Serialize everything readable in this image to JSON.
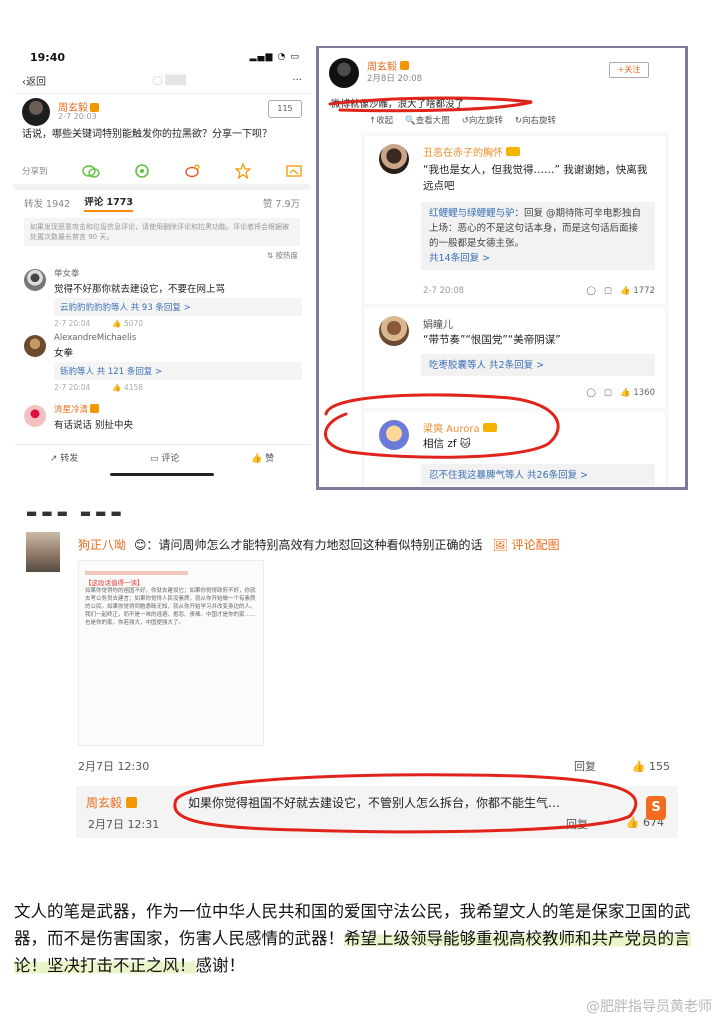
{
  "panel1": {
    "status_time": "19:40",
    "back_label": "返回",
    "post_author": "周玄毅",
    "post_time": "2-7 20:03",
    "follow_count": "115",
    "post_text": "话说，哪些关键词特别能触发你的拉黑欲？分享一下呗？",
    "share_label": "分享到",
    "tab_repost": "转发 1942",
    "tab_comment": "评论 1773",
    "tab_likes": "赞 7.9万",
    "notice": "如果发现恶意攻击和垃圾信息评论，请使用删除评论和拉黑功能。评论者将会根据被处置次数最长禁言 90 天。",
    "sort_label": "按热度",
    "comments": [
      {
        "name": "单女拳",
        "text": "觉得不好那你就去建设它，不要在网上骂",
        "reply": "云豹豹豹豹豹等人  共 93 条回复 >",
        "time": "2-7 20:04",
        "likes": "5070"
      },
      {
        "name": "AlexandreMichaelis",
        "text": "女拳",
        "reply": "铄豹等人  共 121 条回复 >",
        "time": "2-7 20:04",
        "likes": "4158"
      },
      {
        "name": "流星冷清",
        "text": "有话说话 别扯中央"
      }
    ],
    "bottom_bar": {
      "repost": "转发",
      "comment": "评论",
      "like": "赞"
    },
    "colors": {
      "accent": "#f88a00",
      "name": "#e86b1c",
      "link": "#3a6fb5"
    }
  },
  "panel2": {
    "author": "周玄毅",
    "time": "2月8日 20:08",
    "follow": "+关注",
    "text": "微博就像沙雕，浪大了啥都没了",
    "toolbar": [
      "收起",
      "查看大图",
      "向左旋转",
      "向右旋转"
    ],
    "items": [
      {
        "name": "丑恶在赤子的胸怀",
        "text": "“我也是女人，但我觉得……” 我谢谢她，快离我远点吧",
        "reply_user": "红鲤鲤与绿鲤鲤与驴",
        "reply_text": "：回复 @期待陈可辛电影独自上场：恶心的不是这句话本身，而是这句话后面接的一般都是女德主张。",
        "reply_more": "共14条回复 >",
        "time": "2-7 20:08",
        "likes": "1772"
      },
      {
        "name": "娟瞳儿",
        "text": "“带节奏”“恨国党”“美帝阴谋”",
        "reply_more": "吃枣胶囊等人  共2条回复 >",
        "likes": "1360"
      },
      {
        "name": "梁爽 Aurora",
        "text": "相信 zf",
        "reply_more": "忍不住我这暴脾气等人  共26条回复 >"
      }
    ]
  },
  "panel3": {
    "name": "狗正八呦",
    "question": "请问周帅怎么才能特别高效有力地怼回这种看似特别正确的话",
    "pic_label": "评论配图",
    "thumb_title": "【这段话值得一读】",
    "thumb_text": "如果你觉得你的祖国不好，你就去建设它；如果你觉得政府不好，你就去考公务员去建言；如果你觉得人民没素质，就从你开始做一个有素质的公民。如果你觉得同胞愚昧无知，就从你开始学习并改变身边的人。我们一起终正，而不是一味的逃避、抱怨、责难。中国才是你的家……也是你的家，你若强大，中国便强大了。",
    "time": "2月7日 12:30",
    "reply": "回复",
    "likes": "155",
    "reply_author": "周玄毅",
    "reply_text": "如果你觉得祖国不好就去建设它，不管别人怎么拆台，你都不能生气…",
    "reply_time": "2月7日 12:31",
    "reply_likes": "674"
  },
  "body": {
    "plain": "文人的笔是武器，作为一位中华人民共和国的爱国守法公民，我希望文人的笔是保家卫国的武器，而不是伤害国家，伤害人民感情的武器！",
    "highlight": "希望上级领导能够重视高校教师和共产党员的言论！坚决打击不正之风！",
    "tail": "感谢！"
  },
  "watermark": "@肥胖指导员黄老师",
  "annotation_color": "#e0241b"
}
